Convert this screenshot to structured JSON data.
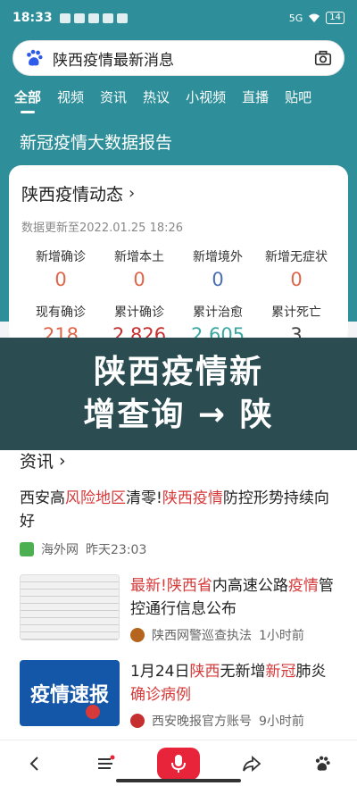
{
  "status_bar": {
    "time": "18:33",
    "network": "5G",
    "battery": "14"
  },
  "search": {
    "query": "陕西疫情最新消息"
  },
  "tabs": [
    "全部",
    "视频",
    "资讯",
    "热议",
    "小视频",
    "直播",
    "贴吧"
  ],
  "report_title": "新冠疫情大数据报告",
  "card": {
    "title": "陕西疫情动态",
    "updated": "数据更新至2022.01.25 18:26",
    "stats_row1": [
      {
        "label": "新增确诊",
        "value": "0",
        "color": "#e0664a"
      },
      {
        "label": "新增本土",
        "value": "0",
        "color": "#e0664a"
      },
      {
        "label": "新增境外",
        "value": "0",
        "color": "#4a6fb5"
      },
      {
        "label": "新增无症状",
        "value": "0",
        "color": "#e0664a"
      }
    ],
    "stats_row2": [
      {
        "label": "现有确诊",
        "value": "218",
        "color": "#e0664a"
      },
      {
        "label": "累计确诊",
        "value": "2,826",
        "color": "#c62f2f"
      },
      {
        "label": "累计治愈",
        "value": "2,605",
        "color": "#3aa7a0"
      },
      {
        "label": "累计死亡",
        "value": "3",
        "color": "#444444"
      }
    ]
  },
  "overlay": {
    "line1": "陕西疫情新",
    "line2": "增查询 → 陕"
  },
  "news_section": {
    "title": "资讯",
    "item1": {
      "t1": "西安高",
      "t2": "风险地区",
      "t3": "清零!",
      "t4": "陕西疫情",
      "t5": "防控形势持续向好",
      "source": "海外网",
      "time": "昨天23:03"
    },
    "item2": {
      "t1": "最新!",
      "t2": "陕西省",
      "t3": "内高速公路",
      "t4": "疫情",
      "t5": "管控通行信息公布",
      "source": "陕西网警巡查执法",
      "time": "1小时前"
    },
    "item3": {
      "thumb_text": "疫情速报",
      "t1": "1月24日",
      "t2": "陕西",
      "t3": "无新增",
      "t4": "新冠",
      "t5": "肺炎",
      "t6": "确诊病例",
      "source": "西安晚报官方账号",
      "time": "9小时前"
    }
  },
  "colors": {
    "accent": "#2e8f9a",
    "highlight": "#d63a3a",
    "mic": "#e8243b"
  }
}
